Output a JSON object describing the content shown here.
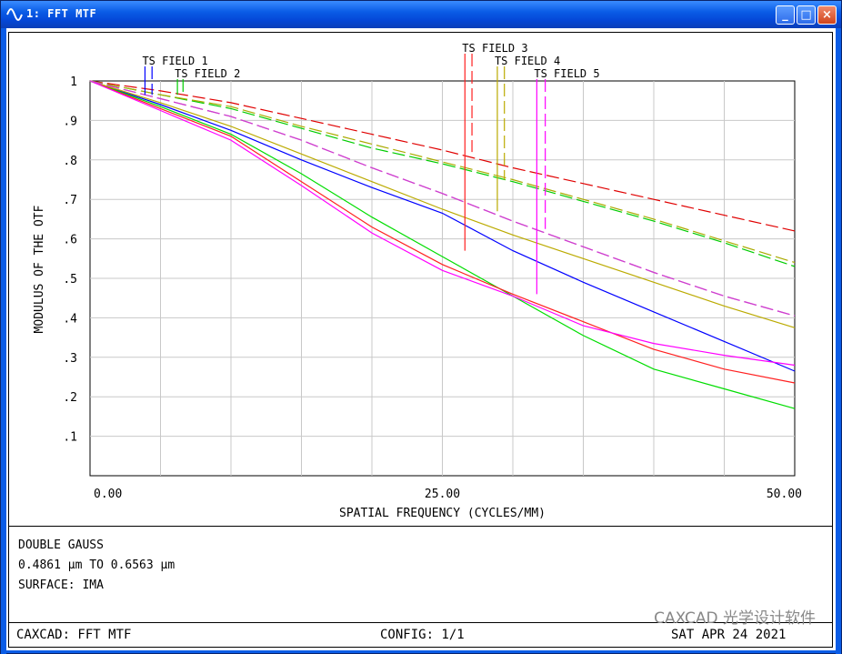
{
  "window": {
    "title": "1: FFT MTF",
    "buttons": {
      "minimize": "_",
      "maximize": "□",
      "close": "×"
    }
  },
  "chart_data": {
    "type": "line",
    "title": "",
    "xlabel": "SPATIAL FREQUENCY (CYCLES/MM)",
    "ylabel": "MODULUS OF THE OTF",
    "xlim": [
      0,
      50
    ],
    "ylim": [
      0,
      1
    ],
    "x_tick_labels": [
      {
        "x": 0,
        "label": "0.00"
      },
      {
        "x": 25,
        "label": "25.00"
      },
      {
        "x": 50,
        "label": "50.00"
      }
    ],
    "y_tick_labels": [
      {
        "y": 1,
        "label": "1"
      },
      {
        "y": 0.9,
        "label": ".9"
      },
      {
        "y": 0.8,
        "label": ".8"
      },
      {
        "y": 0.7,
        "label": ".7"
      },
      {
        "y": 0.6,
        "label": ".6"
      },
      {
        "y": 0.5,
        "label": ".5"
      },
      {
        "y": 0.4,
        "label": ".4"
      },
      {
        "y": 0.3,
        "label": ".3"
      },
      {
        "y": 0.2,
        "label": ".2"
      },
      {
        "y": 0.1,
        "label": ".1"
      }
    ],
    "grid": true,
    "grid_x_step": 5,
    "grid_y_step": 0.1,
    "x": [
      0,
      5,
      10,
      15,
      20,
      25,
      30,
      35,
      40,
      45,
      50
    ],
    "series": [
      {
        "name": "TS FIELD 1",
        "style": "solid",
        "color": "#0000ff",
        "values": [
          1,
          0.94,
          0.875,
          0.8,
          0.73,
          0.665,
          0.57,
          0.49,
          0.415,
          0.34,
          0.265
        ]
      },
      {
        "name": "TS FIELD 1",
        "style": "dashed",
        "color": "#e00000",
        "values": [
          1,
          0.975,
          0.945,
          0.905,
          0.865,
          0.825,
          0.78,
          0.74,
          0.7,
          0.66,
          0.62
        ]
      },
      {
        "name": "TS FIELD 2",
        "style": "solid",
        "color": "#00dd00",
        "values": [
          1,
          0.935,
          0.865,
          0.765,
          0.655,
          0.555,
          0.455,
          0.355,
          0.27,
          0.22,
          0.17
        ]
      },
      {
        "name": "TS FIELD 2",
        "style": "dashed",
        "color": "#00cc00",
        "values": [
          1,
          0.965,
          0.93,
          0.88,
          0.83,
          0.79,
          0.745,
          0.695,
          0.645,
          0.59,
          0.53
        ]
      },
      {
        "name": "TS FIELD 3",
        "style": "solid",
        "color": "#ff2020",
        "values": [
          1,
          0.93,
          0.86,
          0.745,
          0.63,
          0.535,
          0.46,
          0.39,
          0.32,
          0.27,
          0.235
        ]
      },
      {
        "name": "TS FIELD 3",
        "style": "dashed",
        "color": "#aaaa00",
        "values": [
          1,
          0.965,
          0.935,
          0.885,
          0.84,
          0.795,
          0.75,
          0.7,
          0.65,
          0.595,
          0.54
        ]
      },
      {
        "name": "TS FIELD 4",
        "style": "solid",
        "color": "#bbaa00",
        "values": [
          1,
          0.945,
          0.885,
          0.815,
          0.745,
          0.675,
          0.61,
          0.55,
          0.49,
          0.43,
          0.375
        ]
      },
      {
        "name": "TS FIELD 4",
        "style": "dashed",
        "color": "#dd00dd",
        "values": [
          1,
          0.955,
          0.91,
          0.85,
          0.78,
          0.715,
          0.645,
          0.58,
          0.515,
          0.455,
          0.405
        ]
      },
      {
        "name": "TS FIELD 5",
        "style": "solid",
        "color": "#ff00ff",
        "values": [
          1,
          0.925,
          0.85,
          0.735,
          0.615,
          0.52,
          0.455,
          0.38,
          0.335,
          0.305,
          0.28
        ]
      },
      {
        "name": "TS FIELD 5",
        "style": "dashed",
        "color": "#cc44cc",
        "values": [
          1,
          0.955,
          0.91,
          0.85,
          0.78,
          0.715,
          0.645,
          0.58,
          0.515,
          0.455,
          0.405
        ]
      }
    ],
    "field_markers": [
      {
        "label": "TS FIELD 1",
        "color": "#0000ff",
        "solid_x": 3.9,
        "dashed_x": 4.4,
        "y_bottom": 0.965,
        "label_row": 1
      },
      {
        "label": "TS FIELD 2",
        "color": "#00cc00",
        "solid_x": 6.2,
        "dashed_x": 6.6,
        "y_bottom": 0.965,
        "label_row": 2
      },
      {
        "label": "TS FIELD 3",
        "color": "#ff2020",
        "solid_x": 26.6,
        "dashed_x": 27.1,
        "y_bottom": 0.57,
        "dashed_y_bottom": 0.82,
        "label_row": 0
      },
      {
        "label": "TS FIELD 4",
        "color": "#bbaa00",
        "solid_x": 28.9,
        "dashed_x": 29.4,
        "y_bottom": 0.67,
        "dashed_y_bottom": 0.75,
        "label_row": 1
      },
      {
        "label": "TS FIELD 5",
        "color": "#ff00ff",
        "solid_x": 31.7,
        "dashed_x": 32.3,
        "y_bottom": 0.46,
        "dashed_y_bottom": 0.625,
        "label_row": 2
      }
    ]
  },
  "info": {
    "lines": [
      "DOUBLE GAUSS",
      "0.4861 µm TO 0.6563 µm",
      "SURFACE: IMA"
    ]
  },
  "footer": {
    "left": "CAXCAD: FFT MTF",
    "center": "CONFIG: 1/1",
    "right": "SAT APR 24 2021"
  },
  "watermark": "CAXCAD 光学设计软件"
}
